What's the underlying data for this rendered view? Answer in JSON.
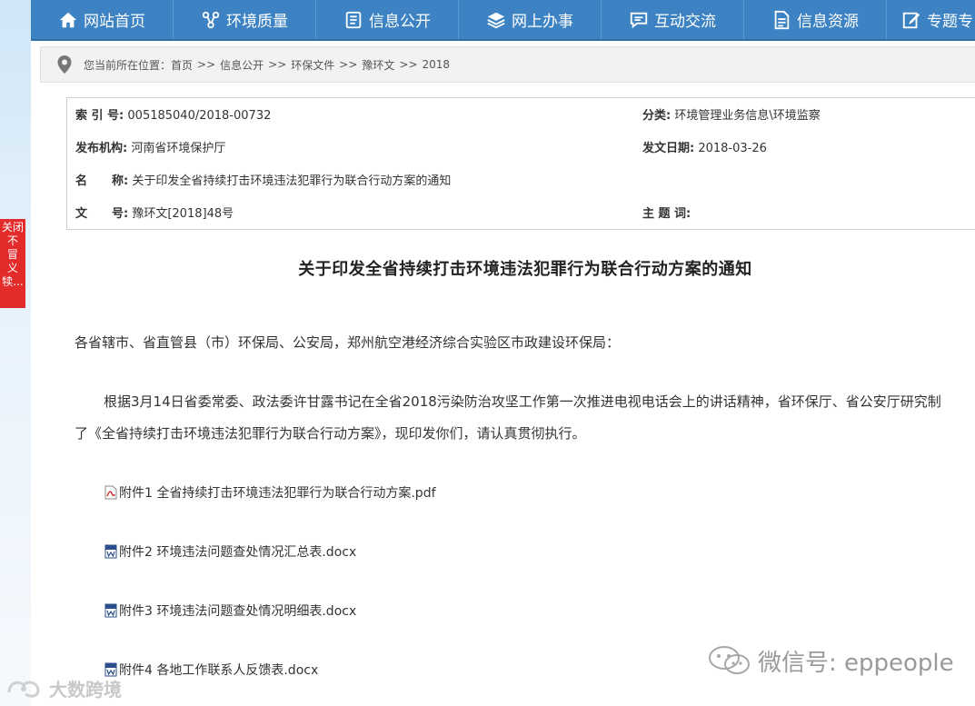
{
  "nav": {
    "items": [
      {
        "label": "网站首页",
        "icon": "home-icon"
      },
      {
        "label": "环境质量",
        "icon": "molecule-icon"
      },
      {
        "label": "信息公开",
        "icon": "document-list-icon"
      },
      {
        "label": "网上办事",
        "icon": "layers-icon"
      },
      {
        "label": "互动交流",
        "icon": "chat-icon"
      },
      {
        "label": "信息资源",
        "icon": "file-icon"
      },
      {
        "label": "专题专",
        "icon": "edit-icon"
      }
    ]
  },
  "breadcrumb": {
    "prefix": "您当前所在位置：",
    "items": [
      "首页",
      "信息公开",
      "环保文件",
      "豫环文",
      "2018"
    ],
    "separator": ">>"
  },
  "info": {
    "index_label": "索 引 号:",
    "index_value": "005185040/2018-00732",
    "category_label": "分类:",
    "category_value": "环境管理业务信息\\环境监察",
    "publisher_label": "发布机构:",
    "publisher_value": "河南省环境保护厅",
    "date_label": "发文日期:",
    "date_value": "2018-03-26",
    "name_label_1": "名",
    "name_label_2": "称:",
    "name_value": "关于印发全省持续打击环境违法犯罪行为联合行动方案的通知",
    "doc_label_1": "文",
    "doc_label_2": "号:",
    "doc_value": "豫环文[2018]48号",
    "keywords_label": "主 题 词:",
    "keywords_value": ""
  },
  "article": {
    "title": "关于印发全省持续打击环境违法犯罪行为联合行动方案的通知",
    "salutation": "各省辖市、省直管县（市）环保局、公安局，郑州航空港经济综合实验区市政建设环保局：",
    "body_line1": "根据3月14日省委常委、政法委许甘露书记在全省2018污染防治攻坚工作第一次推进电视电话会上的讲话精神，省环保厅、省公安厅研究制",
    "body_line2": "了《全省持续打击环境违法犯罪行为联合行动方案》，现印发你们，请认真贯彻执行。",
    "attachments": [
      {
        "label": "附件1 全省持续打击环境违法犯罪行为联合行动方案.pdf",
        "type": "pdf"
      },
      {
        "label": "附件2 环境违法问题查处情况汇总表.docx",
        "type": "docx"
      },
      {
        "label": "附件3 环境违法问题查处情况明细表.docx",
        "type": "docx"
      },
      {
        "label": "附件4 各地工作联系人反馈表.docx",
        "type": "docx"
      }
    ]
  },
  "float_panel": {
    "lines": [
      "关闭",
      "不",
      "冒",
      "义",
      "犊..."
    ]
  },
  "watermark": {
    "right_text": "微信号: eppeople",
    "left_text": "大数跨境"
  },
  "colors": {
    "nav_bg": "#3d83c4",
    "float_panel_bg": "#e32b2b"
  }
}
